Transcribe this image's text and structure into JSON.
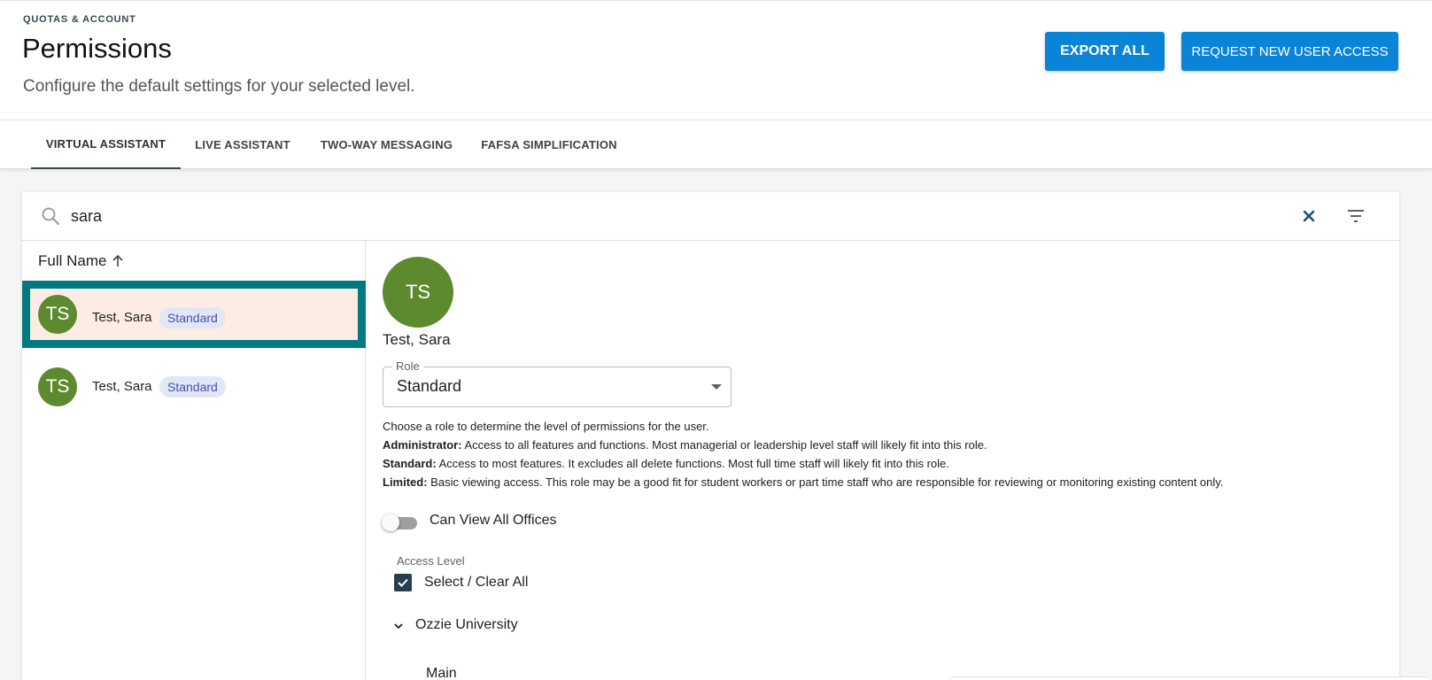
{
  "header": {
    "eyebrow": "QUOTAS & ACCOUNT",
    "title": "Permissions",
    "subtitle": "Configure the default settings for your selected level.",
    "export_label": "EXPORT ALL",
    "request_label": "REQUEST NEW USER ACCESS"
  },
  "tabs": [
    {
      "label": "VIRTUAL ASSISTANT",
      "active": true
    },
    {
      "label": "LIVE ASSISTANT",
      "active": false
    },
    {
      "label": "TWO-WAY MESSAGING",
      "active": false
    },
    {
      "label": "FAFSA SIMPLIFICATION",
      "active": false
    }
  ],
  "search": {
    "value": "sara",
    "icons": {
      "search": "search-icon",
      "clear": "close-icon",
      "filter": "filter-icon"
    }
  },
  "list": {
    "column_header": "Full Name",
    "sort_icon": "arrow-up-icon",
    "rows": [
      {
        "initials": "TS",
        "name": "Test, Sara",
        "badge": "Standard",
        "selected": true
      },
      {
        "initials": "TS",
        "name": "Test, Sara",
        "badge": "Standard",
        "selected": false
      }
    ]
  },
  "detail": {
    "initials": "TS",
    "name": "Test, Sara",
    "role": {
      "label": "Role",
      "value": "Standard"
    },
    "help": {
      "intro": "Choose a role to determine the level of permissions for the user.",
      "admin_term": "Administrator:",
      "admin_text": " Access to all features and functions. Most managerial or leadership level staff will likely fit into this role.",
      "standard_term": "Standard:",
      "standard_text": " Access to most features. It excludes all delete functions. Most full time staff will likely fit into this role.",
      "limited_term": "Limited:",
      "limited_text": " Basic viewing access. This role may be a good fit for student workers or part time staff who are responsible for reviewing or monitoring existing content only."
    },
    "toggle": {
      "label": "Can View All Offices",
      "on": false
    },
    "access": {
      "label": "Access Level",
      "select_all_label": "Select / Clear All",
      "checked": true
    },
    "tree": {
      "root": "Ozzie University",
      "child": "Main"
    }
  },
  "colors": {
    "primary": "#0a84d6",
    "avatar": "#5e8a2f",
    "selected_border": "#007a80",
    "selected_bg": "#fdece4",
    "badge_bg": "#e3e6f5",
    "badge_text": "#3f51b5"
  }
}
